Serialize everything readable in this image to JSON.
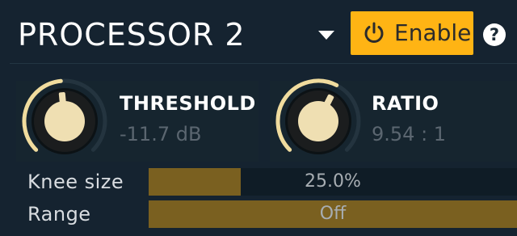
{
  "header": {
    "title": "PROCESSOR 2",
    "enable_label": "Enable",
    "help_label": "?",
    "icons": {
      "dropdown": "chevron-down-icon",
      "enable": "power-icon"
    }
  },
  "threshold": {
    "name": "THRESHOLD",
    "value": "-11.7 dB",
    "level": 0.48
  },
  "ratio": {
    "name": "RATIO",
    "value": "9.54 : 1",
    "level": 0.6
  },
  "knee": {
    "label": "Knee size",
    "value": "25.0%",
    "fill_fraction": 0.25
  },
  "range": {
    "label": "Range",
    "value": "Off",
    "fill_fraction": 1.0
  },
  "colors": {
    "accent": "#ffb414",
    "background": "#152330",
    "knob_face": "#efdfb2",
    "knob_ring": "#f0dc9e",
    "slider_fill": "#7a6020",
    "slider_track": "#0f1c26"
  }
}
